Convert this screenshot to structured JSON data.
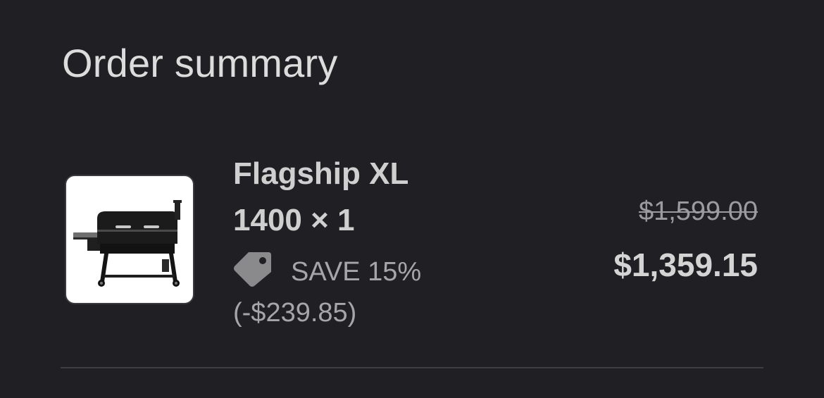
{
  "order_summary": {
    "title": "Order summary",
    "item": {
      "name": "Flagship XL",
      "variant": "1400 × 1",
      "discount_label": "SAVE 15% (-$239.85)",
      "original_price": "$1,599.00",
      "final_price": "$1,359.15",
      "thumbnail_icon": "pellet-grill-image"
    }
  }
}
